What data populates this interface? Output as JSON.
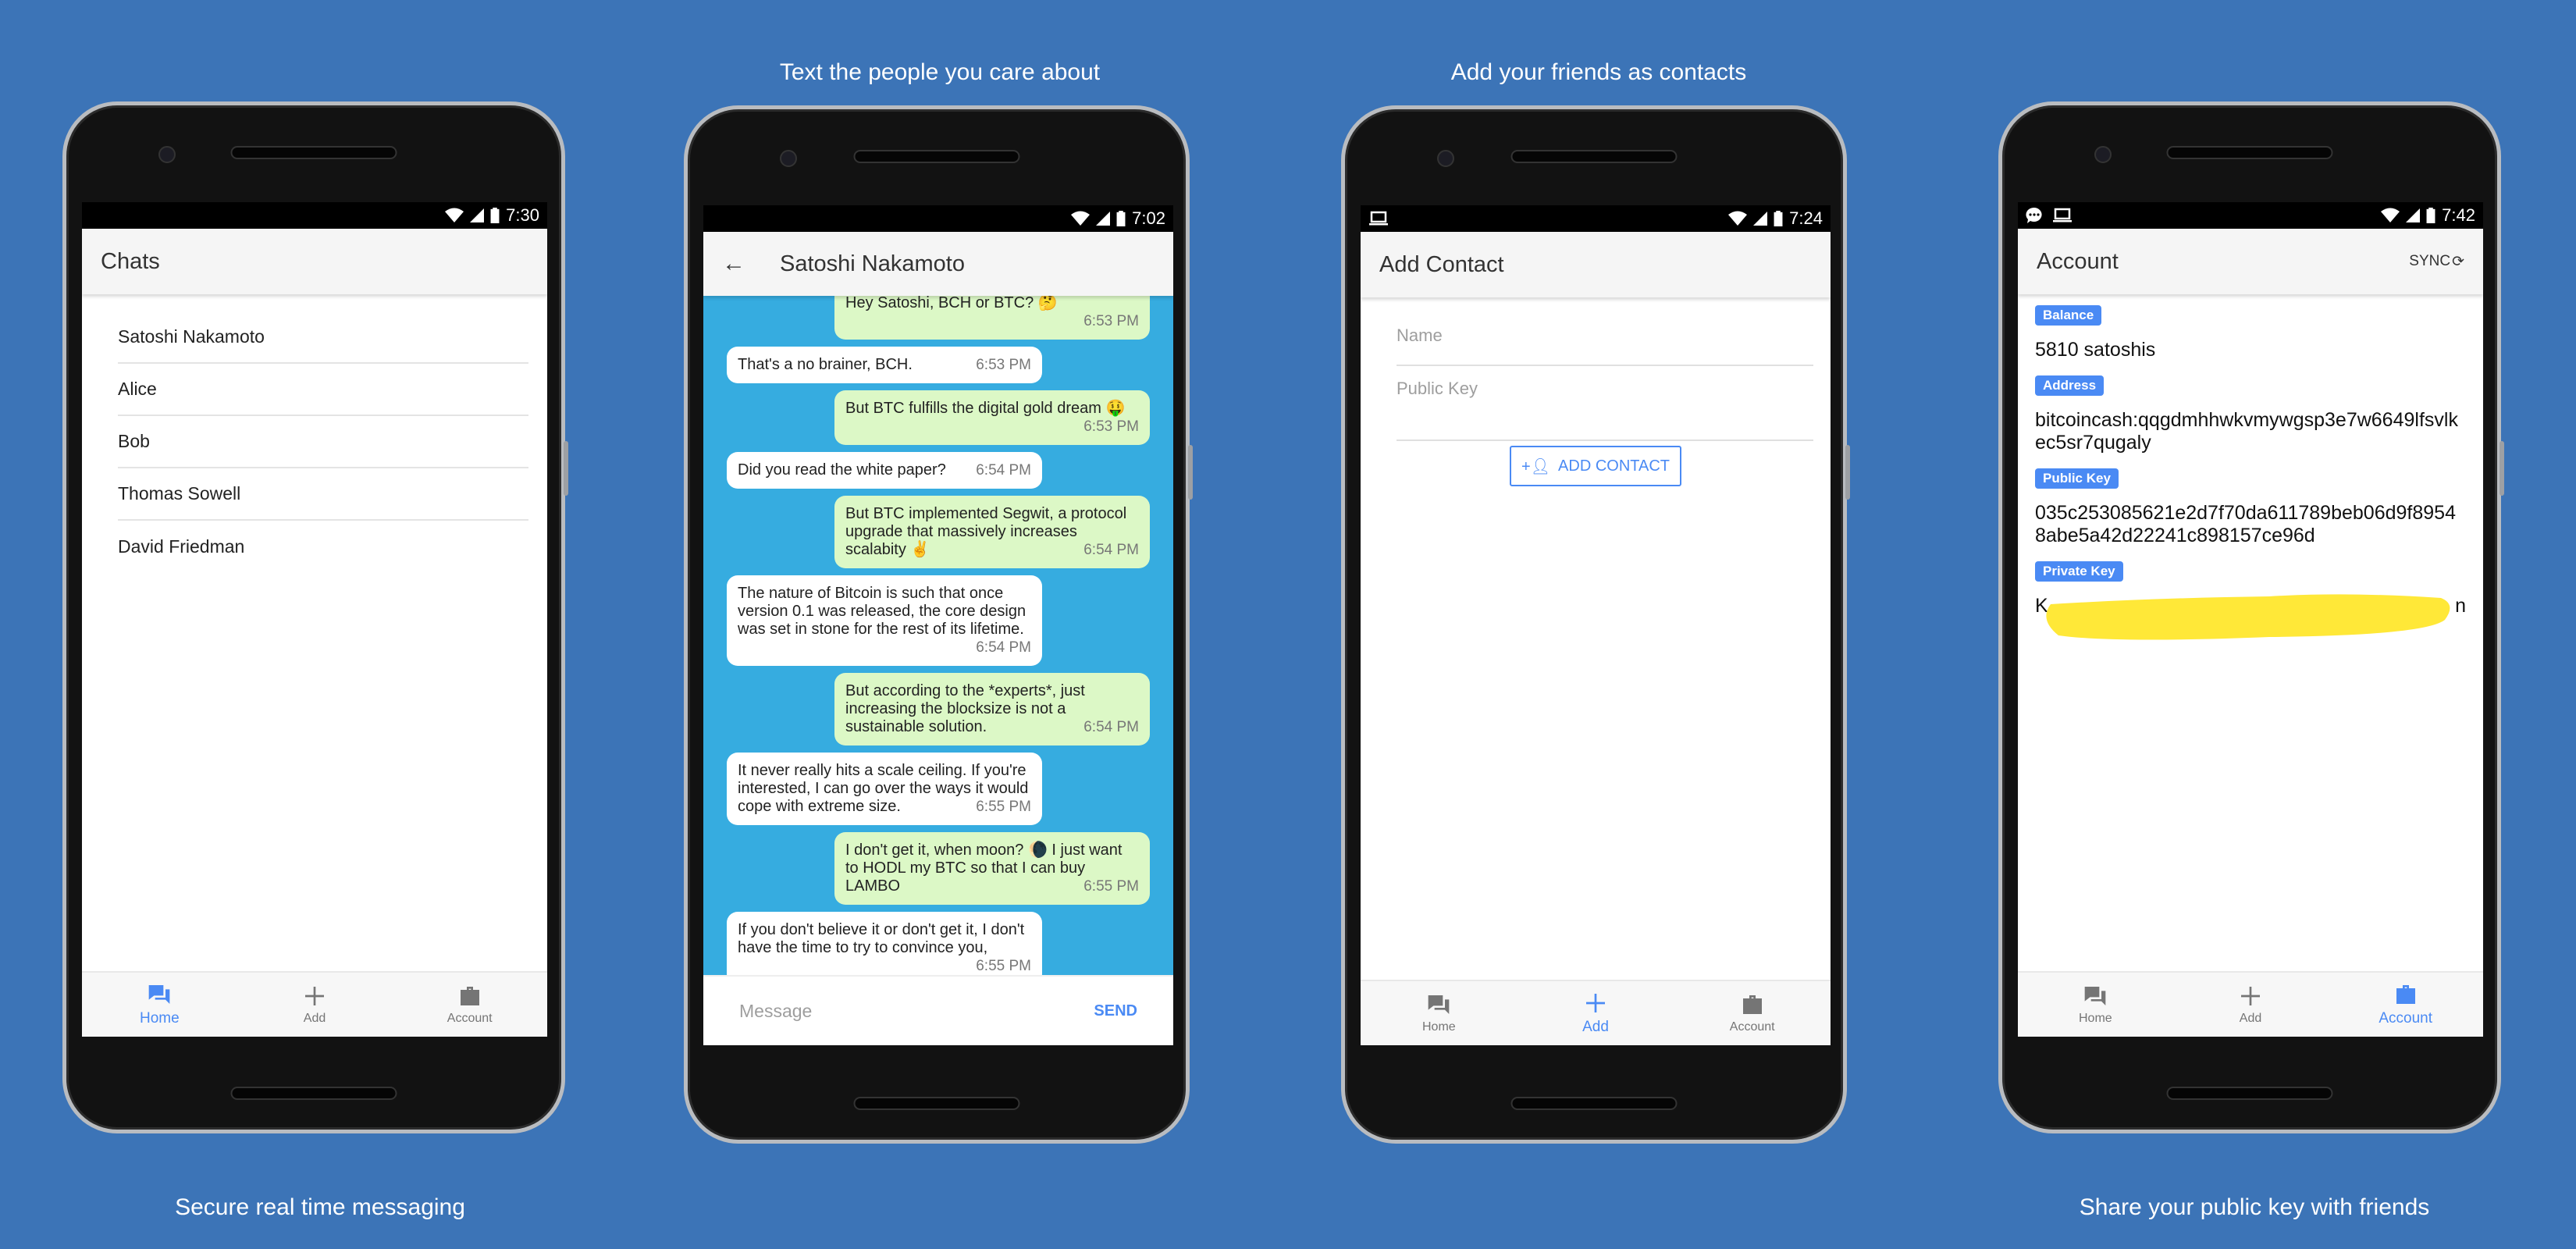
{
  "captions": {
    "chat": "Text the people you care about",
    "add": "Add your friends as contacts",
    "home": "Secure real time messaging",
    "account": "Share your public key with friends"
  },
  "colors": {
    "background": "#3c74b7",
    "accent": "#4a8af4",
    "chat_background": "#36ace0",
    "sent_bubble": "#dcf8c6",
    "redaction": "#ffe838"
  },
  "nav": {
    "home": "Home",
    "add": "Add",
    "account": "Account"
  },
  "home": {
    "time": "7:30",
    "title": "Chats",
    "contacts": [
      "Satoshi Nakamoto",
      "Alice",
      "Bob",
      "Thomas Sowell",
      "David Friedman"
    ]
  },
  "chat": {
    "time": "7:02",
    "title": "Satoshi Nakamoto",
    "placeholder": "Message",
    "send": "SEND",
    "messages": [
      {
        "dir": "out",
        "text": "Hey Satoshi, BCH or BTC? 🤔",
        "time": "6:53 PM"
      },
      {
        "dir": "in",
        "text": "That's a no brainer, BCH.",
        "time": "6:53 PM"
      },
      {
        "dir": "out",
        "text": "But BTC fulfills the digital gold dream 🤑",
        "time": "6:53 PM"
      },
      {
        "dir": "in",
        "text": "Did you read the white paper?",
        "time": "6:54 PM"
      },
      {
        "dir": "out",
        "text": "But BTC implemented Segwit, a protocol upgrade that massively increases scalabity ✌",
        "time": "6:54 PM"
      },
      {
        "dir": "in",
        "text": "The nature of Bitcoin is such that once version 0.1 was released, the core design was set in stone for the rest of its lifetime.",
        "time": "6:54 PM"
      },
      {
        "dir": "out",
        "text": "But according to the *experts*, just increasing the blocksize is not a sustainable solution.",
        "time": "6:54 PM"
      },
      {
        "dir": "in",
        "text": "It never really hits a scale ceiling. If you're interested, I can go over the ways it would cope with extreme size.",
        "time": "6:55 PM"
      },
      {
        "dir": "out",
        "text": "I don't get it, when moon? 🌘 I just want to HODL my BTC so that I can buy LAMBO",
        "time": "6:55 PM"
      },
      {
        "dir": "in",
        "text": "If you don't believe it or don't get it, I don't have the time to try to convince you,",
        "time": "6:55 PM"
      }
    ]
  },
  "add_contact": {
    "time": "7:24",
    "title": "Add Contact",
    "name_placeholder": "Name",
    "key_placeholder": "Public Key",
    "button": "ADD CONTACT"
  },
  "account": {
    "time": "7:42",
    "title": "Account",
    "sync": "SYNC",
    "balance_label": "Balance",
    "balance": "5810 satoshis",
    "address_label": "Address",
    "address": "bitcoincash:qqgdmhhwkvmywgsp3e7w6649lfsvlkec5sr7qugaly",
    "pubkey_label": "Public Key",
    "pubkey": "035c253085621e2d7f70da611789beb06d9f89548abe5a42d22241c898157ce96d",
    "privkey_label": "Private Key",
    "privkey_visible_start": "K",
    "privkey_visible_end": "n"
  }
}
